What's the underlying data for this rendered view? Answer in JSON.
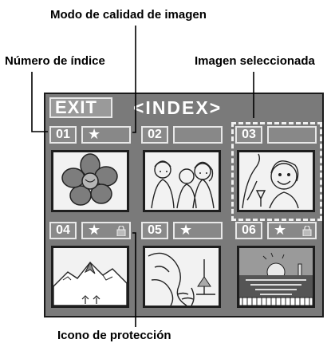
{
  "callouts": {
    "quality_mode": "Modo de calidad de imagen",
    "index_number": "Número de índice",
    "selected_image": "Imagen seleccionada",
    "protection_icon": "Icono de protección"
  },
  "screen": {
    "exit_label": "EXIT",
    "index_label": "<INDEX>",
    "thumbnails": [
      {
        "number": "01",
        "star": true,
        "protected": false,
        "selected": false,
        "subject": "flower"
      },
      {
        "number": "02",
        "star": false,
        "protected": false,
        "selected": false,
        "subject": "people"
      },
      {
        "number": "03",
        "star": false,
        "protected": false,
        "selected": true,
        "subject": "woman-with-glass"
      },
      {
        "number": "04",
        "star": true,
        "protected": true,
        "selected": false,
        "subject": "mountain"
      },
      {
        "number": "05",
        "star": true,
        "protected": false,
        "selected": false,
        "subject": "woman-by-sea"
      },
      {
        "number": "06",
        "star": true,
        "protected": true,
        "selected": false,
        "subject": "sunset"
      }
    ]
  },
  "colors": {
    "screen_bg": "#7a7a7a",
    "text": "#ffffff",
    "callout": "#000000"
  }
}
